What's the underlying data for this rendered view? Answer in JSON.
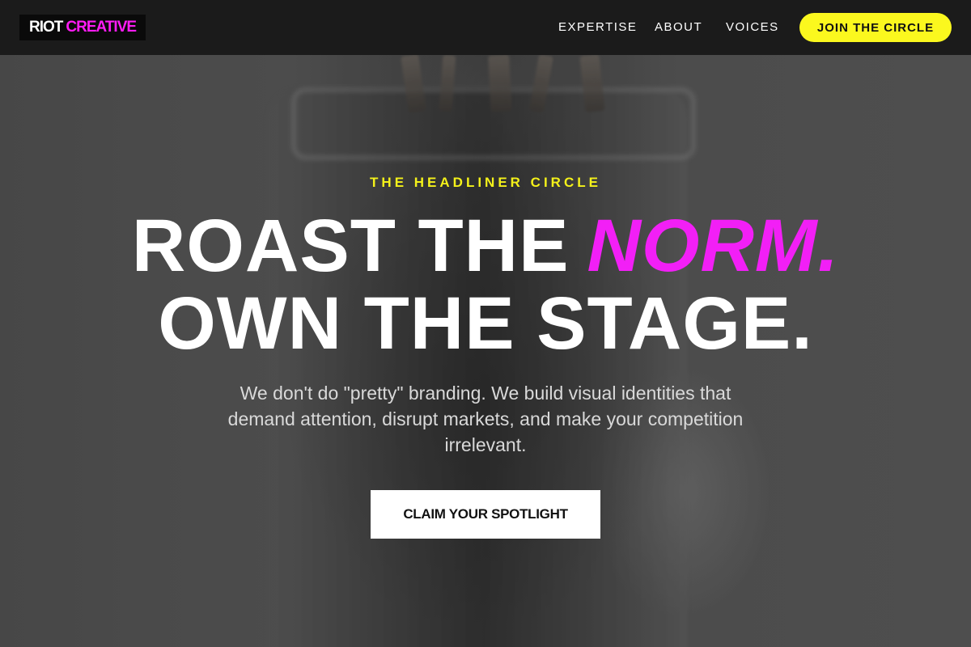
{
  "brand": {
    "logo_word1": "RIOT",
    "logo_word2": "CREATIVE",
    "accent_color": "#ff1cf4",
    "cta_color": "#fbf81e"
  },
  "nav": {
    "items": [
      {
        "label": "EXPERTISE"
      },
      {
        "label": "ABOUT"
      },
      {
        "label": "VOICES"
      }
    ],
    "cta_label": "JOIN THE CIRCLE"
  },
  "hero": {
    "eyebrow": "THE HEADLINER CIRCLE",
    "headline_line1_main": "ROAST THE",
    "headline_line1_accent": "NORM.",
    "headline_line2": "OWN THE STAGE.",
    "subtext": "We don't do \"pretty\" branding. We build visual identities that demand attention, disrupt markets, and make your competition irrelevant.",
    "cta_label": "CLAIM YOUR SPOTLIGHT"
  }
}
